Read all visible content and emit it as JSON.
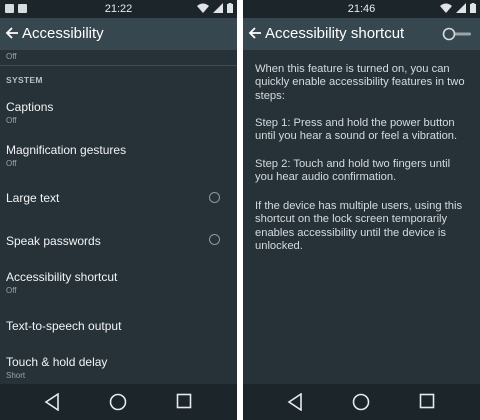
{
  "left": {
    "status": {
      "time": "21:22"
    },
    "appbar": {
      "title": "Accessibility"
    },
    "top_subtitle": "Off",
    "section": "SYSTEM",
    "items": [
      {
        "label": "Captions",
        "sub": "Off"
      },
      {
        "label": "Magnification gestures",
        "sub": "Off"
      },
      {
        "label": "Large text",
        "sub": ""
      },
      {
        "label": "Speak passwords",
        "sub": ""
      },
      {
        "label": "Accessibility shortcut",
        "sub": "Off"
      },
      {
        "label": "Text-to-speech output",
        "sub": ""
      },
      {
        "label": "Touch & hold delay",
        "sub": "Short"
      }
    ]
  },
  "right": {
    "status": {
      "time": "21:46"
    },
    "appbar": {
      "title": "Accessibility shortcut"
    },
    "toggle_on": false,
    "paragraphs": [
      "When this feature is turned on, you can quickly enable accessibility features in two steps:",
      "Step 1: Press and hold the power button until you hear a sound or feel a vibration.",
      "Step 2: Touch and hold two fingers until you hear audio confirmation.",
      "If the device has multiple users, using this shortcut on the lock screen temporarily enables accessibility until the device is unlocked."
    ]
  },
  "colors": {
    "background": "#263238",
    "appbar": "#37474f",
    "statusbar": "#1c2529",
    "secondary_text": "#9aa5aa"
  }
}
